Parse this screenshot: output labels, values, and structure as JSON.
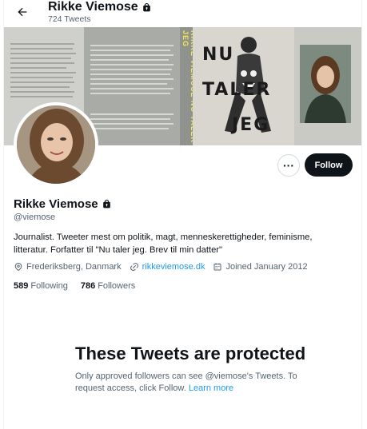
{
  "header": {
    "name": "Rikke Viemose",
    "tweet_count": "724 Tweets"
  },
  "banner": {
    "spine_text": "RIKKE VIEMOSE    NU TALER JEG",
    "cover_title_1": "NU",
    "cover_title_2": "TALER",
    "cover_title_3": "JEG"
  },
  "profile": {
    "name": "Rikke Viemose",
    "handle": "@viemose",
    "bio": "Journalist. Tweeter mest om politik, magt, menneskerettigheder, feminisme, litteratur. Forfatter til \"Nu taler jeg. Brev til min datter\"",
    "location": "Frederiksberg, Danmark",
    "website": "rikkeviemose.dk",
    "joined": "Joined January 2012",
    "following_count": "589",
    "following_label": "Following",
    "followers_count": "786",
    "followers_label": "Followers"
  },
  "actions": {
    "more_label": "···",
    "follow_label": "Follow"
  },
  "protected": {
    "title": "These Tweets are protected",
    "desc": "Only approved followers can see @viemose's Tweets. To request access, click Follow.",
    "learn_more": "Learn more"
  },
  "colors": {
    "accent": "#1d9bf0",
    "text_primary": "#0f1419",
    "text_secondary": "#536471",
    "button_dark": "#0f1419"
  }
}
